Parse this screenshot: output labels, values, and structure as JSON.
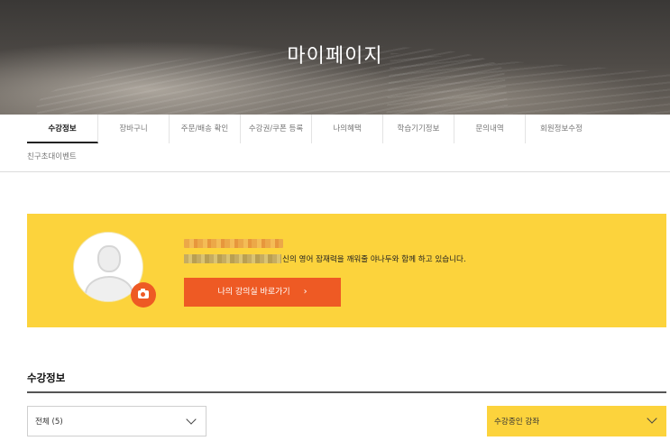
{
  "hero": {
    "title": "마이페이지"
  },
  "tabs": [
    {
      "label": "수강정보",
      "active": true
    },
    {
      "label": "장바구니",
      "active": false
    },
    {
      "label": "주문/배송 확인",
      "active": false
    },
    {
      "label": "수강권/쿠폰 등록",
      "active": false
    },
    {
      "label": "나의혜택",
      "active": false
    },
    {
      "label": "학습기기정보",
      "active": false
    },
    {
      "label": "문의내역",
      "active": false
    },
    {
      "label": "회원정보수정",
      "active": false
    }
  ],
  "tabs_row2": [
    {
      "label": "친구초대이벤트"
    }
  ],
  "profile": {
    "message": "신의 영어 잠재력을 깨워줄 야나두와 함께 하고 있습니다.",
    "classroom_button": "나의 강의실 바로가기",
    "classroom_chevron": "›"
  },
  "section": {
    "title": "수강정보",
    "filter_all": "전체 (5)",
    "filter_status": "수강중인 강좌"
  },
  "colors": {
    "accent_yellow": "#fcd33c",
    "accent_orange": "#ee5a24"
  },
  "icons": [
    "camera-icon",
    "chevron-down-icon",
    "chevron-right-icon",
    "avatar-placeholder-icon"
  ]
}
